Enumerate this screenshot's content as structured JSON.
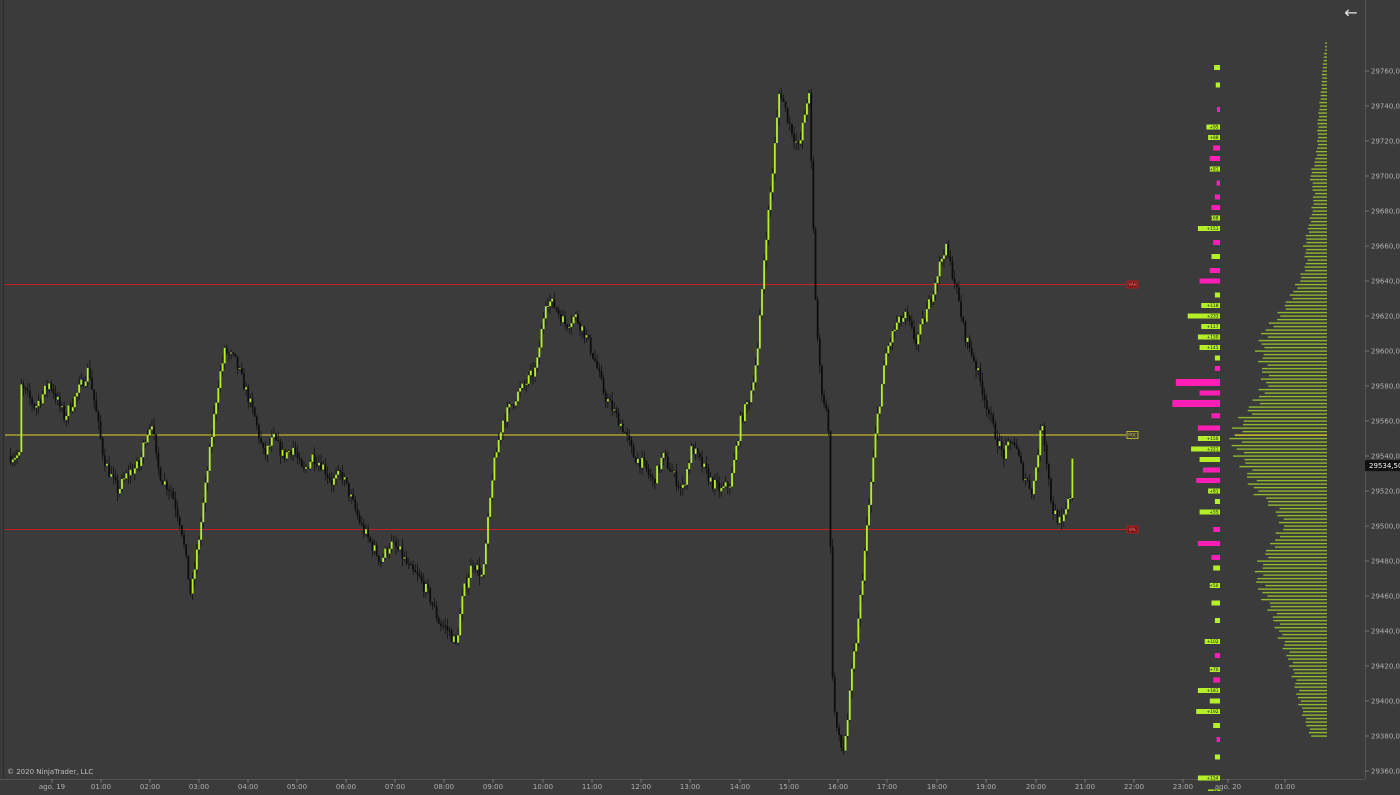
{
  "copyright": "© 2020 NinjaTrader, LLC",
  "back_icon": "arrow-left-icon",
  "colors": {
    "background": "#3b3b3b",
    "up_candle": "#b5f026",
    "down_candle": "#0d0d0d",
    "poc_line": "#d8d027",
    "range_line": "#c42222",
    "profile_bar": "#8fb82e",
    "delta_positive": "#b5f026",
    "delta_negative": "#ff1fb4",
    "axis_text": "#b0b0b0"
  },
  "chart_data": {
    "type": "candlestick",
    "ylim": [
      29360,
      29780
    ],
    "y_ticks": [
      "29360,00",
      "29380,00",
      "29400,00",
      "29420,00",
      "29440,00",
      "29460,00",
      "29480,00",
      "29500,00",
      "29520,00",
      "29540,00",
      "29560,00",
      "29580,00",
      "29600,00",
      "29620,00",
      "29640,00",
      "29660,00",
      "29680,00",
      "29700,00",
      "29720,00",
      "29740,00",
      "29760,00"
    ],
    "x_ticks": [
      "ago. 19",
      "01:00",
      "02:00",
      "03:00",
      "04:00",
      "05:00",
      "06:00",
      "07:00",
      "08:00",
      "09:00",
      "10:00",
      "11:00",
      "12:00",
      "13:00",
      "14:00",
      "15:00",
      "16:00",
      "17:00",
      "18:00",
      "19:00",
      "20:00",
      "21:00",
      "22:00",
      "23:00",
      "ago. 20",
      "01:00"
    ],
    "current_price": "29534,50",
    "current_price_value": 29534.5,
    "levels": [
      {
        "label": "VAH",
        "value": 29638,
        "kind": "range"
      },
      {
        "label": "POC",
        "value": 29552,
        "kind": "poc"
      },
      {
        "label": "VAL",
        "value": 29498,
        "kind": "range"
      }
    ],
    "price_path": {
      "start_hour": 0,
      "end_hour": 21,
      "hours": [
        -0.6,
        -0.3,
        0.0,
        0.3,
        0.55,
        0.8,
        1.1,
        1.2,
        1.4,
        1.6,
        1.85,
        1.95,
        2.1,
        2.2,
        2.3,
        2.5,
        2.7,
        2.9,
        3.1,
        3.3,
        3.45,
        3.6,
        3.8,
        4.0,
        4.2,
        4.4,
        4.6,
        4.8,
        5.0,
        5.2,
        5.4,
        5.6,
        5.8,
        6.0,
        6.2,
        6.4,
        6.6,
        6.8,
        7.0,
        7.2,
        7.4,
        7.6,
        7.8,
        8.0,
        8.2,
        8.35,
        8.5,
        8.7,
        8.9,
        9.1,
        9.3,
        9.6,
        9.8,
        10.0,
        10.2,
        10.4,
        10.6,
        10.8,
        11.0,
        11.2,
        11.4,
        11.6,
        11.8,
        12.0,
        12.2,
        12.4,
        12.6,
        12.8,
        13.0,
        13.2,
        13.4,
        13.6,
        13.8,
        14.0,
        14.2,
        14.4,
        14.55,
        14.7,
        14.85,
        15.0,
        15.2,
        15.4,
        15.6,
        15.75,
        15.85,
        16.0,
        16.1,
        16.2,
        16.3,
        16.4,
        16.5,
        16.6,
        16.8,
        17.0,
        17.2,
        17.4,
        17.6,
        17.8,
        18.0,
        18.2,
        18.4,
        18.6,
        18.8,
        19.0,
        19.2,
        19.4,
        19.6,
        19.8,
        20.0,
        20.2,
        20.4,
        20.6,
        20.8,
        21.0
      ],
      "prices": [
        29580,
        29568,
        29582,
        29562,
        29575,
        29590,
        29540,
        29532,
        29520,
        29530,
        29535,
        29550,
        29560,
        29535,
        29527,
        29520,
        29500,
        29460,
        29500,
        29545,
        29580,
        29600,
        29595,
        29580,
        29563,
        29540,
        29550,
        29540,
        29545,
        29530,
        29540,
        29535,
        29525,
        29530,
        29515,
        29500,
        29490,
        29480,
        29490,
        29485,
        29475,
        29470,
        29460,
        29445,
        29440,
        29432,
        29462,
        29480,
        29470,
        29530,
        29560,
        29575,
        29582,
        29590,
        29630,
        29625,
        29615,
        29620,
        29610,
        29595,
        29575,
        29565,
        29555,
        29540,
        29535,
        29525,
        29540,
        29530,
        29520,
        29545,
        29535,
        29525,
        29520,
        29525,
        29560,
        29575,
        29600,
        29660,
        29700,
        29750,
        29730,
        29715,
        29750,
        29620,
        29580,
        29560,
        29400,
        29380,
        29370,
        29390,
        29420,
        29440,
        29500,
        29560,
        29600,
        29615,
        29620,
        29605,
        29620,
        29640,
        29660,
        29640,
        29610,
        29595,
        29575,
        29555,
        29540,
        29550,
        29530,
        29520,
        29560,
        29510,
        29500,
        29520,
        29545,
        29550,
        29540
      ]
    },
    "volume_profile": {
      "low": 29380,
      "high": 29776,
      "peak_price": 29552,
      "bins": [
        [
          29380,
          0.17
        ],
        [
          29390,
          0.24
        ],
        [
          29400,
          0.3
        ],
        [
          29410,
          0.34
        ],
        [
          29420,
          0.38
        ],
        [
          29430,
          0.45
        ],
        [
          29440,
          0.52
        ],
        [
          29450,
          0.58
        ],
        [
          29460,
          0.68
        ],
        [
          29470,
          0.74
        ],
        [
          29480,
          0.7
        ],
        [
          29490,
          0.58
        ],
        [
          29500,
          0.47
        ],
        [
          29510,
          0.55
        ],
        [
          29520,
          0.78
        ],
        [
          29530,
          0.84
        ],
        [
          29540,
          0.94
        ],
        [
          29550,
          1.0
        ],
        [
          29560,
          0.92
        ],
        [
          29570,
          0.78
        ],
        [
          29580,
          0.66
        ],
        [
          29590,
          0.68
        ],
        [
          29600,
          0.72
        ],
        [
          29610,
          0.68
        ],
        [
          29620,
          0.52
        ],
        [
          29630,
          0.4
        ],
        [
          29640,
          0.3
        ],
        [
          29650,
          0.22
        ],
        [
          29660,
          0.24
        ],
        [
          29670,
          0.2
        ],
        [
          29680,
          0.16
        ],
        [
          29690,
          0.14
        ],
        [
          29700,
          0.18
        ],
        [
          29710,
          0.12
        ],
        [
          29720,
          0.1
        ],
        [
          29730,
          0.1
        ],
        [
          29740,
          0.08
        ],
        [
          29750,
          0.06
        ],
        [
          29760,
          0.05
        ],
        [
          29770,
          0.03
        ]
      ]
    },
    "delta_bars": [
      {
        "price": 29762,
        "value": 0.35,
        "label": ""
      },
      {
        "price": 29752,
        "value": 0.25,
        "label": ""
      },
      {
        "price": 29738,
        "value": -0.15,
        "label": ""
      },
      {
        "price": 29728,
        "value": 0.8,
        "label": "+95"
      },
      {
        "price": 29722,
        "value": 0.7,
        "label": "+88"
      },
      {
        "price": 29716,
        "value": -0.4,
        "label": ""
      },
      {
        "price": 29710,
        "value": -0.6,
        "label": ""
      },
      {
        "price": 29704,
        "value": 0.6,
        "label": "+81"
      },
      {
        "price": 29696,
        "value": -0.2,
        "label": ""
      },
      {
        "price": 29688,
        "value": -0.3,
        "label": ""
      },
      {
        "price": 29682,
        "value": -0.5,
        "label": ""
      },
      {
        "price": 29676,
        "value": 0.5,
        "label": "+68"
      },
      {
        "price": 29670,
        "value": 1.3,
        "label": "+151"
      },
      {
        "price": 29662,
        "value": -0.4,
        "label": ""
      },
      {
        "price": 29654,
        "value": 0.5,
        "label": ""
      },
      {
        "price": 29646,
        "value": -0.6,
        "label": ""
      },
      {
        "price": 29640,
        "value": -1.2,
        "label": ""
      },
      {
        "price": 29632,
        "value": 0.3,
        "label": ""
      },
      {
        "price": 29626,
        "value": 1.1,
        "label": "+118"
      },
      {
        "price": 29620,
        "value": 1.9,
        "label": "+233"
      },
      {
        "price": 29614,
        "value": 1.1,
        "label": "+117"
      },
      {
        "price": 29608,
        "value": 1.3,
        "label": "+150"
      },
      {
        "price": 29602,
        "value": 1.2,
        "label": "+145"
      },
      {
        "price": 29596,
        "value": 0.3,
        "label": ""
      },
      {
        "price": 29590,
        "value": -0.3,
        "label": ""
      },
      {
        "price": 29582,
        "value": -2.6,
        "label": ""
      },
      {
        "price": 29576,
        "value": -1.2,
        "label": ""
      },
      {
        "price": 29570,
        "value": -2.8,
        "label": ""
      },
      {
        "price": 29563,
        "value": -0.5,
        "label": ""
      },
      {
        "price": 29556,
        "value": -1.3,
        "label": ""
      },
      {
        "price": 29550,
        "value": 1.3,
        "label": "+150"
      },
      {
        "price": 29544,
        "value": 1.7,
        "label": "+221"
      },
      {
        "price": 29538,
        "value": 1.2,
        "label": ""
      },
      {
        "price": 29532,
        "value": -1.0,
        "label": ""
      },
      {
        "price": 29526,
        "value": -1.4,
        "label": ""
      },
      {
        "price": 29520,
        "value": 0.7,
        "label": "+81"
      },
      {
        "price": 29514,
        "value": 0.3,
        "label": ""
      },
      {
        "price": 29508,
        "value": 1.2,
        "label": "+55"
      },
      {
        "price": 29498,
        "value": -0.4,
        "label": ""
      },
      {
        "price": 29490,
        "value": -1.3,
        "label": ""
      },
      {
        "price": 29482,
        "value": -0.5,
        "label": ""
      },
      {
        "price": 29476,
        "value": 0.4,
        "label": ""
      },
      {
        "price": 29466,
        "value": 0.6,
        "label": "+50"
      },
      {
        "price": 29456,
        "value": 0.5,
        "label": ""
      },
      {
        "price": 29446,
        "value": 0.3,
        "label": ""
      },
      {
        "price": 29434,
        "value": 0.9,
        "label": "+102"
      },
      {
        "price": 29426,
        "value": -0.3,
        "label": ""
      },
      {
        "price": 29418,
        "value": 0.6,
        "label": "+70"
      },
      {
        "price": 29412,
        "value": -0.4,
        "label": ""
      },
      {
        "price": 29406,
        "value": 1.3,
        "label": "+181"
      },
      {
        "price": 29400,
        "value": 0.6,
        "label": ""
      },
      {
        "price": 29394,
        "value": 1.4,
        "label": "+192"
      },
      {
        "price": 29386,
        "value": 0.4,
        "label": ""
      },
      {
        "price": 29378,
        "value": -0.2,
        "label": ""
      },
      {
        "price": 29368,
        "value": 0.3,
        "label": ""
      },
      {
        "price": 29356,
        "value": 1.3,
        "label": "+154"
      },
      {
        "price": 29348,
        "value": 0.7,
        "label": "+85"
      },
      {
        "price": 29342,
        "value": 0.3,
        "label": ""
      },
      {
        "price": 29334,
        "value": 0.2,
        "label": ""
      },
      {
        "price": 29326,
        "value": 0.15,
        "label": ""
      }
    ]
  }
}
